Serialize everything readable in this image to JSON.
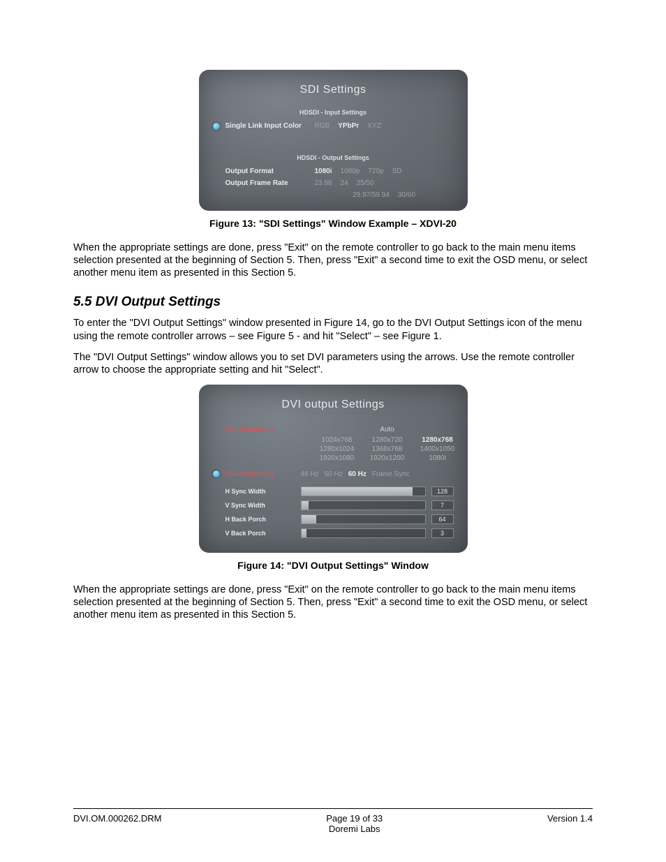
{
  "osd1": {
    "title": "SDI Settings",
    "input_section": "HDSDI - Input Settings",
    "input_row_label": "Single Link Input Color",
    "input_opts": [
      "RGB",
      "YPbPr",
      "XYZ'"
    ],
    "output_section": "HDSDI - Output Settings",
    "format_label": "Output Format",
    "format_opts": [
      "1080i",
      "1080p",
      "720p",
      "SD"
    ],
    "rate_label": "Output Frame Rate",
    "rate_opts_line1": [
      "23.98",
      "24",
      "25/50"
    ],
    "rate_opts_line2": [
      "29.97/59.94",
      "30/60"
    ]
  },
  "fig13": "Figure 13: \"SDI Settings\" Window Example – XDVI-20",
  "p1": "When the appropriate settings are done, press \"Exit\" on the remote controller to go back to the main menu items selection presented at the beginning of Section 5. Then, press \"Exit\" a second time to exit the OSD menu, or select another menu item as presented in this Section 5.",
  "heading": "5.5  DVI Output Settings",
  "p2": "To enter the \"DVI Output Settings\" window presented in Figure 14, go to the DVI Output Settings icon of the menu using the remote controller arrows – see Figure 5 - and hit \"Select\" – see Figure 1.",
  "p3": "The \"DVI Output Settings\" window allows you to set DVI parameters using the arrows. Use the remote controller arrow to choose the appropriate setting and hit \"Select\".",
  "osd2": {
    "title": "DVI output Settings",
    "res_label": "DVI Resolution",
    "res_auto": "Auto",
    "res_rows": [
      [
        "1024x768",
        "1280x720",
        "1280x768"
      ],
      [
        "1280x1024",
        "1368x768",
        "1400x1050"
      ],
      [
        "1920x1080",
        "1920x1200",
        "1080i"
      ]
    ],
    "res_highlight": "1280x768",
    "freq_label": "DVI Frequency",
    "freq_opts": [
      "48 Hz",
      "50 Hz",
      "60 Hz",
      "Frame Sync"
    ],
    "freq_highlight": "60 Hz",
    "sliders": [
      {
        "label": "H Sync Width",
        "value": "128",
        "pct": 90
      },
      {
        "label": "V Sync Width",
        "value": "7",
        "pct": 6
      },
      {
        "label": "H Back Porch",
        "value": "64",
        "pct": 12
      },
      {
        "label": "V Back Porch",
        "value": "3",
        "pct": 4
      }
    ]
  },
  "fig14": "Figure 14: \"DVI Output Settings\" Window",
  "p4": "When the appropriate settings are done, press \"Exit\" on the remote controller to go back to the main menu items selection presented at the beginning of Section 5. Then, press \"Exit\" a second time to exit the OSD menu, or select another menu item as presented in this Section 5.",
  "footer": {
    "left": "DVI.OM.000262.DRM",
    "mid1": "Page 19 of 33",
    "mid2": "Doremi Labs",
    "right": "Version 1.4"
  }
}
